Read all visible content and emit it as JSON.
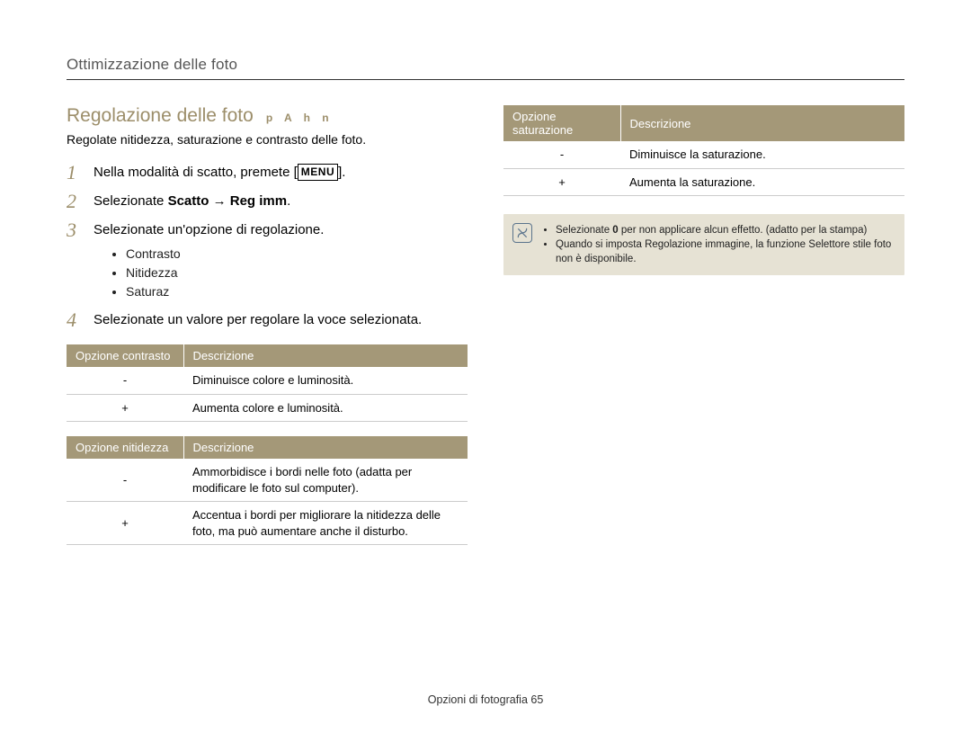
{
  "section_title": "Ottimizzazione delle foto",
  "heading": "Regolazione delle foto",
  "modes": "p A h n",
  "intro": "Regolate nitidezza, saturazione e contrasto delle foto.",
  "steps": {
    "s1_num": "1",
    "s1_a": "Nella modalità di scatto, premete [",
    "s1_menu": "MENU",
    "s1_b": "].",
    "s2_num": "2",
    "s2_a": "Selezionate ",
    "s2_bold": "Scatto → Reg imm",
    "s2_b": ".",
    "s3_num": "3",
    "s3": "Selezionate un'opzione di regolazione.",
    "s3_items": {
      "a": "Contrasto",
      "b": "Nitidezza",
      "c": "Saturaz"
    },
    "s4_num": "4",
    "s4": "Selezionate un valore per regolare la voce selezionata."
  },
  "tables": {
    "contrast": {
      "h1": "Opzione contrasto",
      "h2": "Descrizione",
      "r1_o": "-",
      "r1_d": "Diminuisce colore e luminosità.",
      "r2_o": "+",
      "r2_d": "Aumenta colore e luminosità."
    },
    "sharp": {
      "h1": "Opzione nitidezza",
      "h2": "Descrizione",
      "r1_o": "-",
      "r1_d": "Ammorbidisce i bordi nelle foto (adatta per modificare le foto sul computer).",
      "r2_o": "+",
      "r2_d": "Accentua i bordi per migliorare la nitidezza delle foto, ma può aumentare anche il disturbo."
    },
    "sat": {
      "h1": "Opzione saturazione",
      "h2": "Descrizione",
      "r1_o": "-",
      "r1_d": "Diminuisce la saturazione.",
      "r2_o": "+",
      "r2_d": "Aumenta la saturazione."
    }
  },
  "note": {
    "n1_a": "Selezionate ",
    "n1_bold": "0",
    "n1_b": " per non applicare alcun effetto. (adatto per la stampa)",
    "n2": "Quando si imposta Regolazione immagine, la funzione Selettore stile foto non è disponibile."
  },
  "footer_a": "Opzioni di fotografia  ",
  "footer_b": "65"
}
